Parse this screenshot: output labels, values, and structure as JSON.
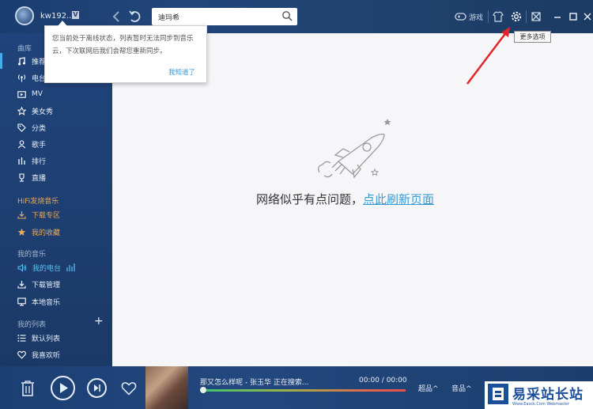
{
  "header": {
    "username": "kw192...",
    "vip_badge": "V",
    "search_placeholder": "",
    "search_value": "迪玛希",
    "game_label": "游戏",
    "tooltip_more_options": "更多选项"
  },
  "popup": {
    "text": "您当前处于离线状态，列表暂时无法同步到音乐云，下次联网后我们会帮您重新同步。",
    "ok": "我知道了"
  },
  "sidebar": {
    "section_library": "曲库",
    "library_items": [
      {
        "label": "推荐",
        "icon": "music-note-icon"
      },
      {
        "label": "电台",
        "icon": "radio-icon"
      },
      {
        "label": "MV",
        "icon": "video-icon"
      },
      {
        "label": "美女秀",
        "icon": "star-icon"
      },
      {
        "label": "分类",
        "icon": "tag-icon"
      },
      {
        "label": "歌手",
        "icon": "person-icon"
      },
      {
        "label": "排行",
        "icon": "bars-icon"
      },
      {
        "label": "直播",
        "icon": "trophy-icon"
      }
    ],
    "section_hifi": "HiFi发烧音乐",
    "hifi_items": [
      {
        "label": "下载专区",
        "icon": "download-icon"
      },
      {
        "label": "我的收藏",
        "icon": "star-filled-icon"
      }
    ],
    "section_my_music": "我的音乐",
    "my_music_items": [
      {
        "label": "我的电台",
        "icon": "speaker-icon"
      },
      {
        "label": "下载管理",
        "icon": "download-icon"
      },
      {
        "label": "本地音乐",
        "icon": "monitor-icon"
      }
    ],
    "section_my_list": "我的列表",
    "list_items": [
      {
        "label": "默认列表",
        "icon": "list-icon"
      },
      {
        "label": "我喜欢听",
        "icon": "heart-icon"
      }
    ]
  },
  "main": {
    "error_text": "网络似乎有点问题，",
    "refresh_link": "点此刷新页面"
  },
  "player": {
    "song_title": "那又怎么样呢 - 张玉华 正在搜索...",
    "time": "00:00 / 00:00",
    "quality_label": "超品",
    "lyrics_label": "音品"
  },
  "watermark": {
    "text": "易采站长站",
    "sub": "Www.Easck.Com Webmaster"
  },
  "colors": {
    "sidebar_bg": "#1f437a",
    "accent_link": "#3a9bd7",
    "hifi_orange": "#e6a95a",
    "active_blue": "#59c3f5"
  }
}
